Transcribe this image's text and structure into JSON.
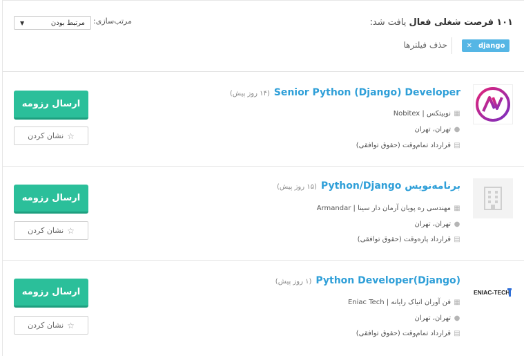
{
  "header": {
    "count_number": "۱۰۱",
    "count_text": "فرصت شغلی فعال",
    "found_text": "یافت شد:",
    "sort_label": "مرتب‌سازی:",
    "sort_value": "مرتبط بودن",
    "filter_chip": "django",
    "clear_filters": "حذف فیلترها"
  },
  "jobs": [
    {
      "title": "Senior Python (Django) Developer",
      "ago": "(۱۴ روز پیش)",
      "company": "نوبیتکس | Nobitex",
      "location": "تهران، تهران",
      "contract": "قرارداد تمام‌وقت (حقوق توافقی)",
      "apply": "ارسال رزومه",
      "save": "نشان کردن"
    },
    {
      "title": "برنامه‌نویس Python/Django",
      "ago": "(۱۵ روز پیش)",
      "company": "مهندسی ره پویان آرمان دار سینا | Armandar",
      "location": "تهران، تهران",
      "contract": "قرارداد پاره‌وقت (حقوق توافقی)",
      "apply": "ارسال رزومه",
      "save": "نشان کردن"
    },
    {
      "title": "Python Developer(Django)",
      "ago": "(۱ روز پیش)",
      "company": "فن آوران انیاک رایانه | Eniac Tech",
      "location": "تهران، تهران",
      "contract": "قرارداد تمام‌وقت (حقوق توافقی)",
      "apply": "ارسال رزومه",
      "save": "نشان کردن",
      "logo_text": "ENIAC-TECH"
    }
  ],
  "colors": {
    "accent_blue": "#2f9fd8",
    "apply_green": "#2bbf9a",
    "chip_blue": "#55b6e5"
  }
}
